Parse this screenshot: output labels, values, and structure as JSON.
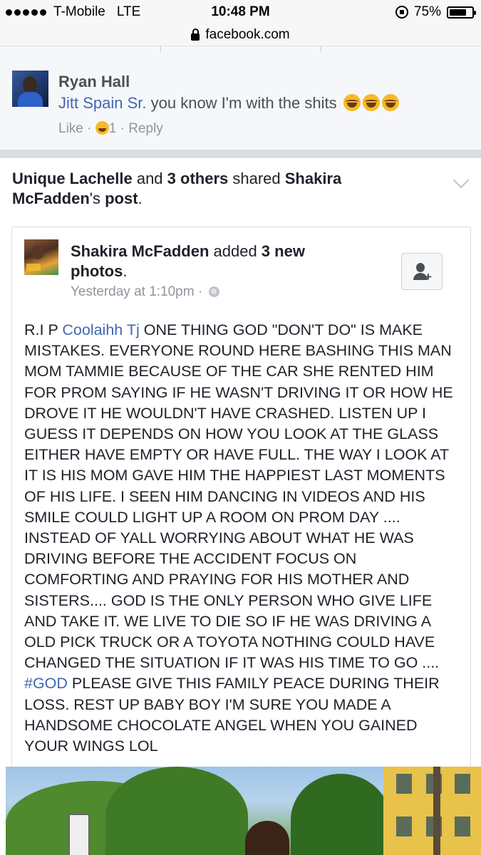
{
  "status_bar": {
    "carrier": "T-Mobile",
    "network": "LTE",
    "time": "10:48 PM",
    "battery": "75%",
    "battery_level": 0.75,
    "signal_dots": 5
  },
  "url_bar": {
    "url": "facebook.com"
  },
  "comment": {
    "author": "Ryan Hall",
    "mention": "Jitt Spain Sr.",
    "text": " you know I'm with the shits",
    "like_label": "Like",
    "separator": " · ",
    "reaction_count": "1",
    "reply_label": "Reply"
  },
  "story": {
    "sharer": "Unique Lachelle",
    "and_text": " and ",
    "others": "3 others",
    "shared_text": " shared ",
    "original_author": "Shakira McFadden",
    "possessive": "'s ",
    "post_word": "post",
    "period": "."
  },
  "post": {
    "author": "Shakira McFadden",
    "added_text": " added ",
    "count_bold": "3 new photos",
    "period": ".",
    "timestamp": "Yesterday at 1:10pm",
    "time_separator": " · ",
    "text_part1": "R.I P ",
    "mention": "Coolaihh Tj",
    "text_part2": " ONE THING GOD \"DON'T DO\" IS MAKE MISTAKES. EVERYONE ROUND HERE BASHING THIS MAN MOM TAMMIE BECAUSE OF THE CAR SHE RENTED HIM FOR PROM SAYING IF HE WASN'T DRIVING IT OR HOW HE DROVE IT HE WOULDN'T HAVE CRASHED. LISTEN UP I GUESS IT DEPENDS ON HOW YOU LOOK AT THE GLASS EITHER HAVE EMPTY OR HAVE FULL. THE WAY I LOOK AT IT IS HIS MOM GAVE HIM THE HAPPIEST LAST MOMENTS OF HIS LIFE. I SEEN HIM DANCING IN VIDEOS AND HIS SMILE COULD LIGHT UP A ROOM ON PROM DAY .... INSTEAD OF YALL WORRYING ABOUT WHAT HE WAS DRIVING BEFORE THE ACCIDENT FOCUS ON COMFORTING AND PRAYING FOR HIS MOTHER AND SISTERS.... GOD IS THE ONLY PERSON WHO GIVE LIFE AND TAKE IT. WE LIVE TO DIE SO IF HE WAS DRIVING A OLD PICK TRUCK OR A TOYOTA NOTHING COULD HAVE CHANGED THE SITUATION IF IT WAS HIS TIME TO GO .... ",
    "hashtag": "#GOD",
    "text_part3": " PLEASE GIVE THIS FAMILY PEACE DURING THEIR LOSS. REST UP BABY BOY I'M SURE YOU MADE A HANDSOME CHOCOLATE ANGEL WHEN YOU GAINED YOUR WINGS LOL"
  },
  "icons": {
    "rotation_lock": "rotation-lock-icon",
    "battery": "battery-icon",
    "lock": "lock-icon",
    "laugh_emoji": "laughing-emoji-icon",
    "chevron": "chevron-down-icon",
    "globe": "globe-icon",
    "add_friend": "add-friend-icon"
  },
  "colors": {
    "link_blue": "#4267b2",
    "meta_gray": "#90949c",
    "text_dark": "#1d2129"
  }
}
